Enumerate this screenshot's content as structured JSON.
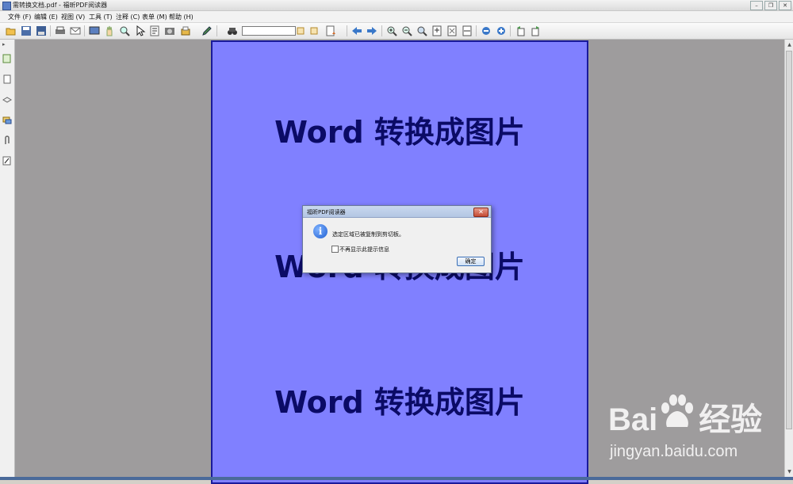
{
  "window": {
    "title": "需转换文档.pdf - 福昕PDF阅读器"
  },
  "menu": [
    {
      "label": "文件 (F)"
    },
    {
      "label": "编辑 (E)"
    },
    {
      "label": "视图 (V)"
    },
    {
      "label": "工具 (T)"
    },
    {
      "label": "注释 (C)"
    },
    {
      "label": "表单 (M)"
    },
    {
      "label": "帮助 (H)"
    }
  ],
  "toolbar": {
    "find_value": ""
  },
  "document": {
    "headings": [
      "Word 转换成图片",
      "Word 转换成图片",
      "Word 转换成图片"
    ]
  },
  "dialog": {
    "title": "福昕PDF阅读器",
    "message": "选定区域已被复制到剪切板。",
    "checkbox_label": "不再显示此提示信息",
    "ok_label": "确定"
  },
  "watermark": {
    "logo_left": "Bai",
    "logo_right": "经验",
    "url": "jingyan.baidu.com"
  },
  "colors": {
    "page_bg": "#8080ff",
    "heading_text": "#0b0b66",
    "canvas_bg": "#9e9c9d"
  }
}
